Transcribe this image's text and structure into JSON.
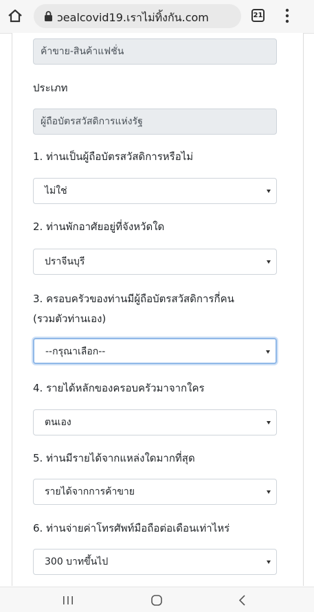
{
  "browser": {
    "url": "ɔealcovid19.เราไม่ทิ้งกัน.com",
    "tab_count": "21"
  },
  "form": {
    "occupation_value": "ค้าขาย-สินค้าแฟชั่น",
    "type_label": "ประเภท",
    "type_value": "ผู้ถือบัตรสวัสดิการแห่งรัฐ",
    "questions": [
      {
        "label": "1. ท่านเป็นผู้ถือบัตรสวัสดิการหรือไม่",
        "selected": "ไม่ใช่"
      },
      {
        "label": "2. ท่านพักอาศัยอยู่ที่จังหวัดใด",
        "selected": "ปราจีนบุรี"
      },
      {
        "label": "3. ครอบครัวของท่านมีผู้ถือบัตรสวัสดิการกี่คน",
        "label_line2": "(รวมตัวท่านเอง)",
        "selected": "--กรุณาเลือก--"
      },
      {
        "label": "4. รายได้หลักของครอบครัวมาจากใคร",
        "selected": "ตนเอง"
      },
      {
        "label": "5. ท่านมีรายได้จากแหล่งใดมากที่สุด",
        "selected": "รายได้จากการค้าขาย"
      },
      {
        "label": "6. ท่านจ่ายค่าโทรศัพท์มือถือต่อเดือนเท่าไหร่",
        "selected": "300 บาทขึ้นไป"
      }
    ]
  }
}
